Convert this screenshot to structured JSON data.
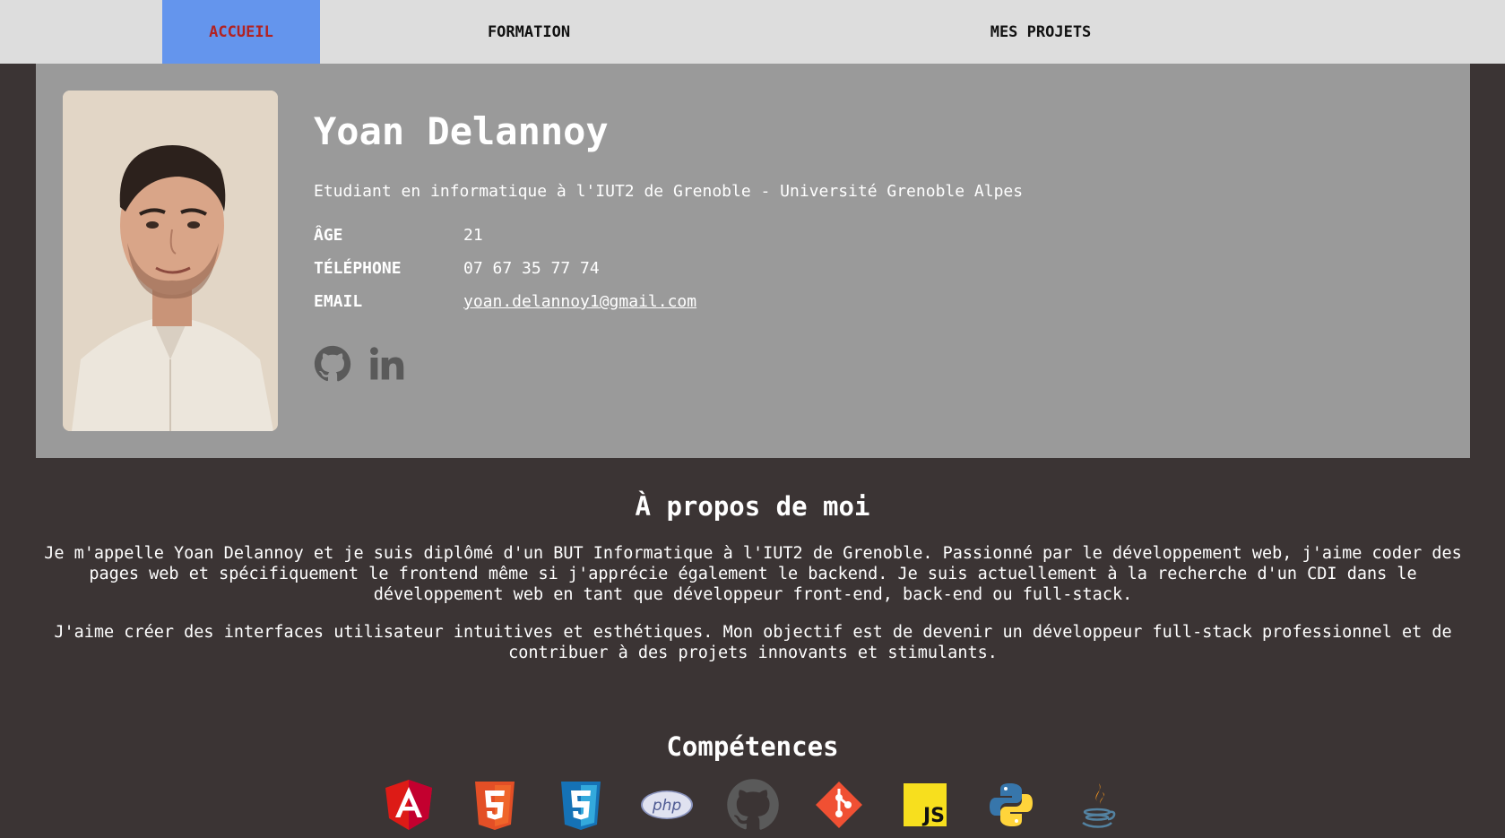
{
  "nav": {
    "items": [
      {
        "label": "ACCUEIL",
        "active": true
      },
      {
        "label": "FORMATION",
        "active": false
      },
      {
        "label": "MES PROJETS",
        "active": false
      }
    ]
  },
  "profile": {
    "name": "Yoan Delannoy",
    "subtitle": "Etudiant en informatique à l'IUT2 de Grenoble - Université Grenoble Alpes",
    "rows": [
      {
        "label": "ÂGE",
        "value": "21"
      },
      {
        "label": "TÉLÉPHONE",
        "value": "07 67 35 77 74"
      },
      {
        "label": "EMAIL",
        "value": "yoan.delannoy1@gmail.com"
      }
    ],
    "socials": [
      "github-icon",
      "linkedin-icon"
    ]
  },
  "about": {
    "title": "À propos de moi",
    "p1": "Je m'appelle Yoan Delannoy et je suis diplômé d'un BUT Informatique à l'IUT2 de Grenoble. Passionné par le développement web, j'aime coder des pages web et spécifiquement le frontend même si j'apprécie également le backend. Je suis actuellement à la recherche d'un CDI dans le développement web en tant que développeur front-end, back-end ou full-stack.",
    "p2": "J'aime créer des interfaces utilisateur intuitives et esthétiques. Mon objectif est de devenir un développeur full-stack professionnel et de contribuer à des projets innovants et stimulants."
  },
  "skills": {
    "title": "Compétences",
    "icons": [
      "angular-icon",
      "html5-icon",
      "css3-icon",
      "php-icon",
      "github-icon",
      "git-icon",
      "javascript-icon",
      "python-icon",
      "java-icon"
    ],
    "php_text": "php",
    "js_text": "JS"
  },
  "colors": {
    "nav_bg": "#dddddd",
    "nav_active_bg": "#6495ed",
    "nav_active_text": "#b22222",
    "page_bg": "#3b3434",
    "card_bg": "#9a9a9a"
  }
}
